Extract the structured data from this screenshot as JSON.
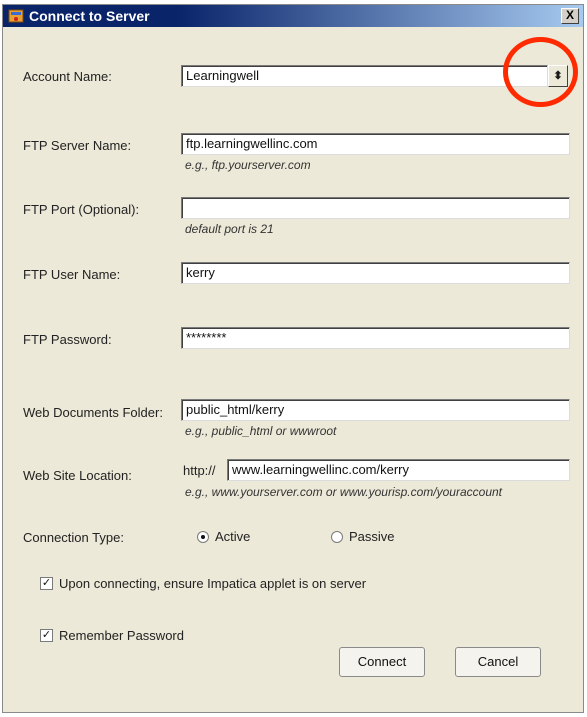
{
  "window": {
    "title": "Connect to Server",
    "close_label": "X"
  },
  "form": {
    "account_name": {
      "label": "Account Name:",
      "value": "Learningwell"
    },
    "ftp_server": {
      "label": "FTP Server Name:",
      "value": "ftp.learningwellinc.com",
      "hint": "e.g.,  ftp.yourserver.com"
    },
    "ftp_port": {
      "label": "FTP Port (Optional):",
      "value": "",
      "hint": "default port is 21"
    },
    "ftp_user": {
      "label": "FTP User Name:",
      "value": "kerry"
    },
    "ftp_password": {
      "label": "FTP Password:",
      "value": "********"
    },
    "web_folder": {
      "label": "Web Documents Folder:",
      "value": "public_html/kerry",
      "hint": "e.g.,  public_html  or  wwwroot"
    },
    "web_site": {
      "label": "Web Site Location:",
      "prefix": "http://",
      "value": "www.learningwellinc.com/kerry",
      "hint": "e.g.,  www.yourserver.com  or  www.yourisp.com/youraccount"
    },
    "connection_type": {
      "label": "Connection Type:",
      "active": "Active",
      "passive": "Passive",
      "selected": "Active"
    },
    "ensure_applet": {
      "label": "Upon connecting, ensure Impatica applet is on server",
      "checked": true
    },
    "remember_password": {
      "label": "Remember Password",
      "checked": true
    }
  },
  "buttons": {
    "connect": "Connect",
    "cancel": "Cancel"
  },
  "colors": {
    "highlight": "#ff2a00",
    "titlebar": "#0a246a"
  }
}
